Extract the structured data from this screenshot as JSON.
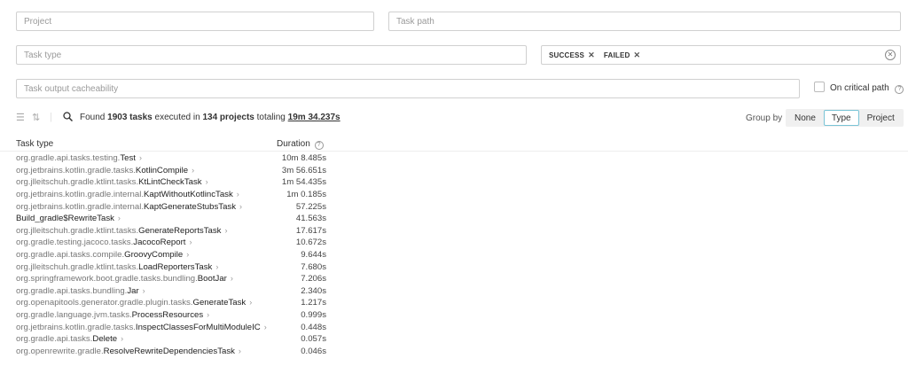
{
  "filters": {
    "project_placeholder": "Project",
    "task_path_placeholder": "Task path",
    "task_type_placeholder": "Task type",
    "outcome_chips": [
      "SUCCESS",
      "FAILED"
    ],
    "cacheability_placeholder": "Task output cacheability",
    "critical_path_label": "On critical path"
  },
  "summary": {
    "found": "Found",
    "task_count": "1903 tasks",
    "executed_in": "executed in",
    "project_count": "134 projects",
    "totaling": "totaling",
    "total_duration": "19m 34.237s"
  },
  "group_by": {
    "label": "Group by",
    "options": [
      "None",
      "Type",
      "Project"
    ],
    "selected": "Type"
  },
  "table": {
    "col_task_type": "Task type",
    "col_duration": "Duration",
    "rows": [
      {
        "pkg": "org.gradle.api.tasks.testing.",
        "cls": "Test",
        "duration": "10m 8.485s"
      },
      {
        "pkg": "org.jetbrains.kotlin.gradle.tasks.",
        "cls": "KotlinCompile",
        "duration": "3m 56.651s"
      },
      {
        "pkg": "org.jlleitschuh.gradle.ktlint.tasks.",
        "cls": "KtLintCheckTask",
        "duration": "1m 54.435s"
      },
      {
        "pkg": "org.jetbrains.kotlin.gradle.internal.",
        "cls": "KaptWithoutKotlincTask",
        "duration": "1m 0.185s"
      },
      {
        "pkg": "org.jetbrains.kotlin.gradle.internal.",
        "cls": "KaptGenerateStubsTask",
        "duration": "57.225s"
      },
      {
        "pkg": "",
        "cls": "Build_gradle$RewriteTask",
        "duration": "41.563s"
      },
      {
        "pkg": "org.jlleitschuh.gradle.ktlint.tasks.",
        "cls": "GenerateReportsTask",
        "duration": "17.617s"
      },
      {
        "pkg": "org.gradle.testing.jacoco.tasks.",
        "cls": "JacocoReport",
        "duration": "10.672s"
      },
      {
        "pkg": "org.gradle.api.tasks.compile.",
        "cls": "GroovyCompile",
        "duration": "9.644s"
      },
      {
        "pkg": "org.jlleitschuh.gradle.ktlint.tasks.",
        "cls": "LoadReportersTask",
        "duration": "7.680s"
      },
      {
        "pkg": "org.springframework.boot.gradle.tasks.bundling.",
        "cls": "BootJar",
        "duration": "7.206s"
      },
      {
        "pkg": "org.gradle.api.tasks.bundling.",
        "cls": "Jar",
        "duration": "2.340s"
      },
      {
        "pkg": "org.openapitools.generator.gradle.plugin.tasks.",
        "cls": "GenerateTask",
        "duration": "1.217s"
      },
      {
        "pkg": "org.gradle.language.jvm.tasks.",
        "cls": "ProcessResources",
        "duration": "0.999s"
      },
      {
        "pkg": "org.jetbrains.kotlin.gradle.tasks.",
        "cls": "InspectClassesForMultiModuleIC",
        "duration": "0.448s"
      },
      {
        "pkg": "org.gradle.api.tasks.",
        "cls": "Delete",
        "duration": "0.057s"
      },
      {
        "pkg": "org.openrewrite.gradle.",
        "cls": "ResolveRewriteDependenciesTask",
        "duration": "0.046s"
      }
    ]
  },
  "icons": {
    "clear": "clear-filter-icon",
    "help": "help-icon",
    "search": "search-icon",
    "expand": "expand-all-icon",
    "sort": "sort-icon"
  }
}
